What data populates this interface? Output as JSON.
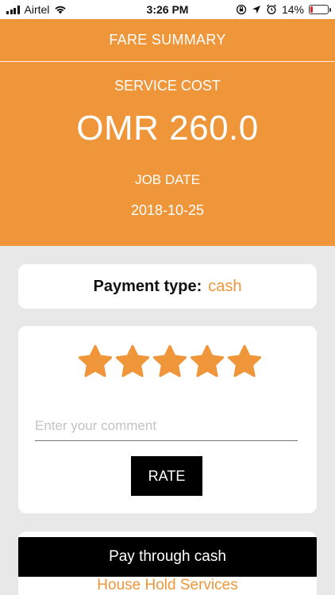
{
  "status_bar": {
    "carrier": "Airtel",
    "time": "3:26 PM",
    "battery_percent": "14%",
    "battery_level": 0.14,
    "icons": [
      "signal-icon",
      "wifi-icon",
      "orientation-lock-icon",
      "location-arrow-icon",
      "alarm-icon",
      "battery-icon"
    ],
    "battery_color": "#e0262b"
  },
  "header": {
    "title": "FARE SUMMARY",
    "service_cost_label": "SERVICE COST",
    "amount": "OMR 260.0",
    "job_date_label": "JOB DATE",
    "job_date": "2018-10-25",
    "background_color": "#f0963a"
  },
  "payment": {
    "label": "Payment type:",
    "value": "cash"
  },
  "rating": {
    "stars_selected": 5,
    "stars_total": 5,
    "star_color": "#f0963a",
    "comment_placeholder": "Enter your comment",
    "comment_value": "",
    "rate_button_label": "RATE"
  },
  "footer": {
    "pay_button_label": "Pay through cash",
    "service_link": "House Hold Services"
  }
}
